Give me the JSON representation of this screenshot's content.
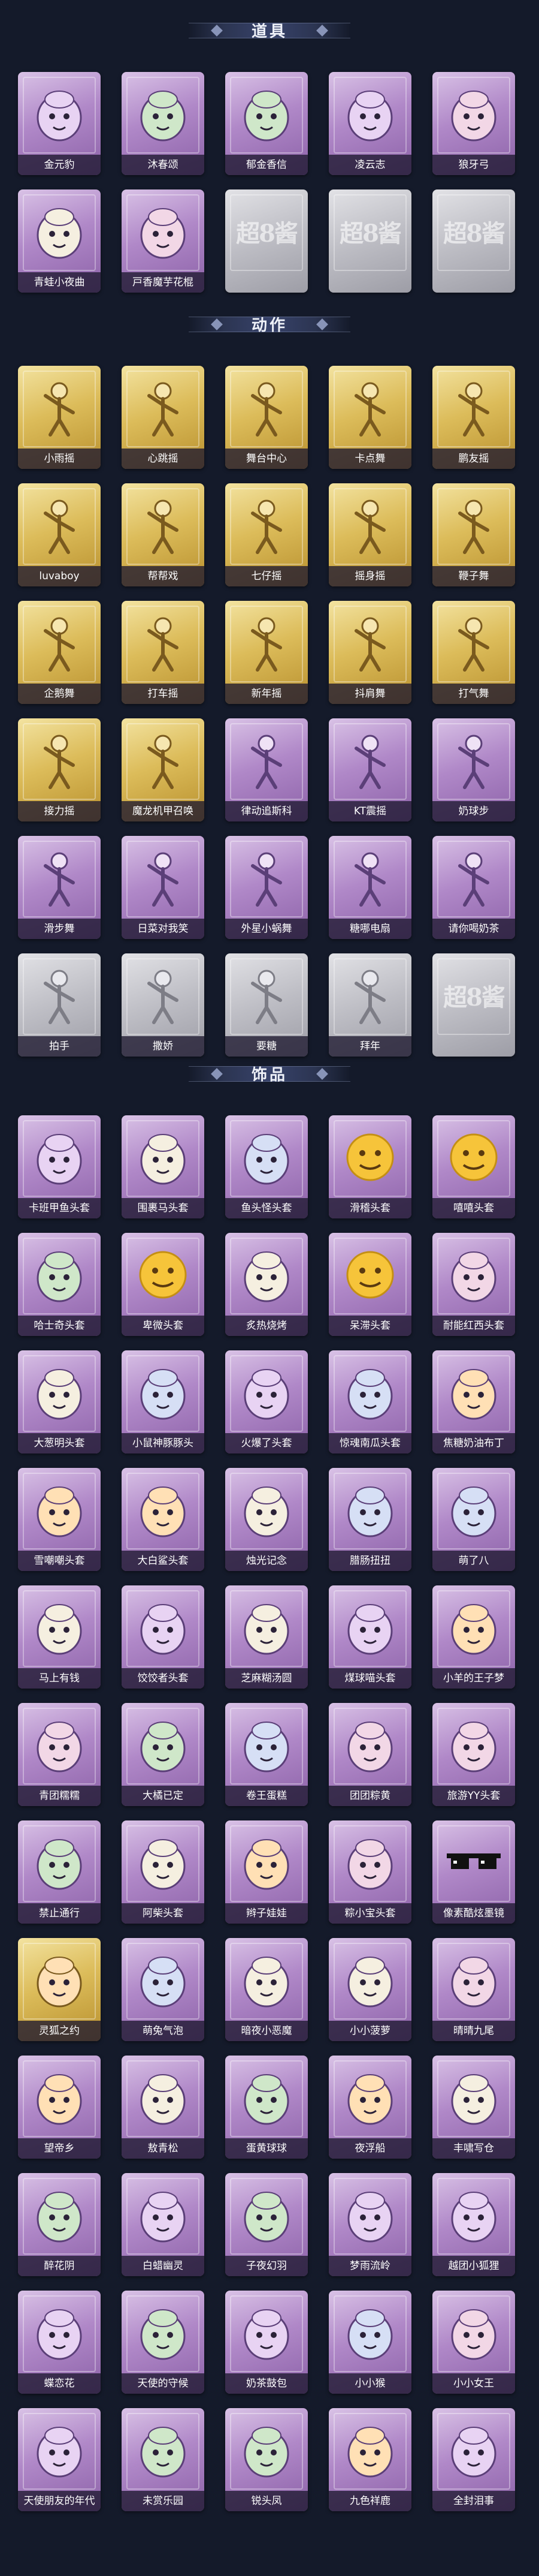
{
  "sections": [
    {
      "title": "道具",
      "items": [
        {
          "label": "金元豹",
          "tone": "purple",
          "icon": "leopard-doll-icon"
        },
        {
          "label": "沐春颂",
          "tone": "purple",
          "icon": "flower-garland-icon"
        },
        {
          "label": "郁金香信",
          "tone": "purple",
          "icon": "tulip-letter-icon"
        },
        {
          "label": "凌云志",
          "tone": "purple",
          "icon": "wing-arrow-icon"
        },
        {
          "label": "狼牙弓",
          "tone": "purple",
          "icon": "bow-icon"
        },
        {
          "label": "青蛙小夜曲",
          "tone": "purple",
          "icon": "frog-icon"
        },
        {
          "label": "戸香魔芋花棍",
          "tone": "purple",
          "icon": "flower-club-icon"
        },
        {
          "label": "",
          "tone": "grey",
          "icon": "placeholder-icon",
          "placeholder": "超8酱"
        },
        {
          "label": "",
          "tone": "grey",
          "icon": "placeholder-icon",
          "placeholder": "超8酱"
        },
        {
          "label": "",
          "tone": "grey",
          "icon": "placeholder-icon",
          "placeholder": "超8酱"
        }
      ]
    },
    {
      "title": "动作",
      "items": [
        {
          "label": "小雨摇",
          "tone": "gold",
          "icon": "dance-pose-icon"
        },
        {
          "label": "心跳摇",
          "tone": "gold",
          "icon": "dance-pose-icon"
        },
        {
          "label": "舞台中心",
          "tone": "gold",
          "icon": "dance-pose-icon"
        },
        {
          "label": "卡点舞",
          "tone": "gold",
          "icon": "dance-pose-icon"
        },
        {
          "label": "鹏友摇",
          "tone": "gold",
          "icon": "dance-pose-icon"
        },
        {
          "label": "luvaboy",
          "tone": "gold",
          "icon": "dance-pose-icon"
        },
        {
          "label": "帮帮戏",
          "tone": "gold",
          "icon": "dance-pose-icon"
        },
        {
          "label": "七仔摇",
          "tone": "gold",
          "icon": "dance-pose-icon"
        },
        {
          "label": "摇身摇",
          "tone": "gold",
          "icon": "dance-pose-icon"
        },
        {
          "label": "鞭子舞",
          "tone": "gold",
          "icon": "dance-pose-icon"
        },
        {
          "label": "企鹅舞",
          "tone": "gold",
          "icon": "dance-pose-icon"
        },
        {
          "label": "打车摇",
          "tone": "gold",
          "icon": "dance-pose-icon"
        },
        {
          "label": "新年摇",
          "tone": "gold",
          "icon": "dance-pose-icon"
        },
        {
          "label": "抖肩舞",
          "tone": "gold",
          "icon": "dance-pose-icon"
        },
        {
          "label": "打气舞",
          "tone": "gold",
          "icon": "dance-pose-icon"
        },
        {
          "label": "接力摇",
          "tone": "gold",
          "icon": "dance-pose-icon"
        },
        {
          "label": "魔龙机甲召唤",
          "tone": "gold",
          "icon": "dance-pose-icon"
        },
        {
          "label": "律动追斯科",
          "tone": "purple",
          "icon": "dance-pose-icon"
        },
        {
          "label": "KT震摇",
          "tone": "purple",
          "icon": "dance-pose-icon"
        },
        {
          "label": "奶球步",
          "tone": "purple",
          "icon": "dance-pose-icon"
        },
        {
          "label": "滑步舞",
          "tone": "purple",
          "icon": "dance-pose-icon"
        },
        {
          "label": "日菜对我笑",
          "tone": "purple",
          "icon": "dance-pose-icon"
        },
        {
          "label": "外星小蜗舞",
          "tone": "purple",
          "icon": "dance-pose-icon"
        },
        {
          "label": "糖哪电扇",
          "tone": "purple",
          "icon": "dance-pose-icon"
        },
        {
          "label": "请你喝奶茶",
          "tone": "purple",
          "icon": "dance-pose-icon"
        },
        {
          "label": "拍手",
          "tone": "grey",
          "icon": "dance-pose-icon"
        },
        {
          "label": "撒娇",
          "tone": "grey",
          "icon": "dance-pose-icon"
        },
        {
          "label": "要糖",
          "tone": "grey",
          "icon": "dance-pose-icon"
        },
        {
          "label": "拜年",
          "tone": "grey",
          "icon": "dance-pose-icon"
        },
        {
          "label": "",
          "tone": "grey",
          "icon": "placeholder-icon",
          "placeholder": "超8酱"
        }
      ]
    },
    {
      "title": "饰品",
      "items": [
        {
          "label": "卡班甲鱼头套",
          "tone": "purple",
          "icon": "penguin-head-icon"
        },
        {
          "label": "围裹马头套",
          "tone": "purple",
          "icon": "horse-head-icon"
        },
        {
          "label": "鱼头怪头套",
          "tone": "purple",
          "icon": "fish-head-icon"
        },
        {
          "label": "滑稽头套",
          "tone": "purple",
          "icon": "emoji-face-icon"
        },
        {
          "label": "嘻嘻头套",
          "tone": "purple",
          "icon": "emoji-face-icon"
        },
        {
          "label": "哈士奇头套",
          "tone": "purple",
          "icon": "husky-head-icon"
        },
        {
          "label": "卑微头套",
          "tone": "purple",
          "icon": "emoji-face-icon"
        },
        {
          "label": "炙热烧烤",
          "tone": "purple",
          "icon": "toast-head-icon"
        },
        {
          "label": "呆滞头套",
          "tone": "purple",
          "icon": "emoji-face-icon"
        },
        {
          "label": "耐能红西头套",
          "tone": "purple",
          "icon": "pikachu-head-icon"
        },
        {
          "label": "大葱明头套",
          "tone": "purple",
          "icon": "bokchoy-head-icon"
        },
        {
          "label": "小鼠神豚豚头",
          "tone": "purple",
          "icon": "pig-head-icon"
        },
        {
          "label": "火爆了头套",
          "tone": "purple",
          "icon": "fire-head-icon"
        },
        {
          "label": "惊魂南瓜头套",
          "tone": "purple",
          "icon": "pumpkin-head-icon"
        },
        {
          "label": "焦糖奶油布丁",
          "tone": "purple",
          "icon": "pudding-head-icon"
        },
        {
          "label": "雪嘲嘲头套",
          "tone": "purple",
          "icon": "snowman-head-icon"
        },
        {
          "label": "大白鲨头套",
          "tone": "purple",
          "icon": "shark-head-icon"
        },
        {
          "label": "烛光记念",
          "tone": "purple",
          "icon": "candle-head-icon"
        },
        {
          "label": "腊肠扭扭",
          "tone": "purple",
          "icon": "dachshund-head-icon"
        },
        {
          "label": "萌了八",
          "tone": "purple",
          "icon": "garlic-head-icon"
        },
        {
          "label": "马上有钱",
          "tone": "purple",
          "icon": "bird-head-icon"
        },
        {
          "label": "饺饺者头套",
          "tone": "purple",
          "icon": "dumpling-head-icon"
        },
        {
          "label": "芝麻糊汤圆",
          "tone": "purple",
          "icon": "tangyuan-head-icon"
        },
        {
          "label": "煤球喵头套",
          "tone": "purple",
          "icon": "cat-head-icon"
        },
        {
          "label": "小羊的王子梦",
          "tone": "purple",
          "icon": "sheep-head-icon"
        },
        {
          "label": "青团糯糯",
          "tone": "purple",
          "icon": "qingtuan-head-icon"
        },
        {
          "label": "大橘已定",
          "tone": "purple",
          "icon": "orange-head-icon"
        },
        {
          "label": "卷王蛋糕",
          "tone": "purple",
          "icon": "cake-head-icon"
        },
        {
          "label": "团团粽黄",
          "tone": "purple",
          "icon": "zongzi-head-icon"
        },
        {
          "label": "旅游YY头套",
          "tone": "purple",
          "icon": "duck-head-icon"
        },
        {
          "label": "禁止通行",
          "tone": "purple",
          "icon": "traffic-cone-icon"
        },
        {
          "label": "阿柴头套",
          "tone": "purple",
          "icon": "shiba-head-icon"
        },
        {
          "label": "辫子娃娃",
          "tone": "purple",
          "icon": "braid-doll-icon"
        },
        {
          "label": "粽小宝头套",
          "tone": "purple",
          "icon": "zongzi-head-icon"
        },
        {
          "label": "像素酷炫墨镜",
          "tone": "purple",
          "icon": "pixel-sunglasses-icon"
        },
        {
          "label": "灵狐之约",
          "tone": "gold",
          "icon": "fox-mask-icon"
        },
        {
          "label": "萌兔气泡",
          "tone": "purple",
          "icon": "rabbit-bubble-icon"
        },
        {
          "label": "暗夜小恶魔",
          "tone": "purple",
          "icon": "devil-pet-icon"
        },
        {
          "label": "小小菠萝",
          "tone": "purple",
          "icon": "pineapple-pet-icon"
        },
        {
          "label": "晴晴九尾",
          "tone": "purple",
          "icon": "ninetail-pet-icon"
        },
        {
          "label": "望帝乡",
          "tone": "purple",
          "icon": "emperor-pet-icon"
        },
        {
          "label": "敖青松",
          "tone": "purple",
          "icon": "pine-pet-icon"
        },
        {
          "label": "蛋黄球球",
          "tone": "purple",
          "icon": "egg-pet-icon"
        },
        {
          "label": "夜浮船",
          "tone": "purple",
          "icon": "boat-pet-icon"
        },
        {
          "label": "丰啸写仓",
          "tone": "purple",
          "icon": "granary-pet-icon"
        },
        {
          "label": "醉花阴",
          "tone": "purple",
          "icon": "flower-pet-icon"
        },
        {
          "label": "白蜡幽灵",
          "tone": "purple",
          "icon": "ghost-pet-icon"
        },
        {
          "label": "子夜幻羽",
          "tone": "purple",
          "icon": "feather-pet-icon"
        },
        {
          "label": "梦雨流岭",
          "tone": "purple",
          "icon": "dreamgirl-pet-icon"
        },
        {
          "label": "越团小狐狸",
          "tone": "purple",
          "icon": "fox-pet-icon"
        },
        {
          "label": "蝶恋花",
          "tone": "purple",
          "icon": "butterfly-pet-icon"
        },
        {
          "label": "天使的守候",
          "tone": "purple",
          "icon": "angel-pet-icon"
        },
        {
          "label": "奶茶鼓包",
          "tone": "purple",
          "icon": "milktea-pet-icon"
        },
        {
          "label": "小小猴",
          "tone": "purple",
          "icon": "monkey-pet-icon"
        },
        {
          "label": "小小女王",
          "tone": "purple",
          "icon": "queen-pet-icon"
        },
        {
          "label": "天使朋友的年代",
          "tone": "purple",
          "icon": "angel-mirror-icon"
        },
        {
          "label": "未赏乐园",
          "tone": "purple",
          "icon": "park-girl-icon"
        },
        {
          "label": "锐头凤",
          "tone": "purple",
          "icon": "phoenix-pet-icon"
        },
        {
          "label": "九色祥鹿",
          "tone": "purple",
          "icon": "deer-pet-icon"
        },
        {
          "label": "全封泪事",
          "tone": "purple",
          "icon": "prince-pet-icon"
        }
      ]
    }
  ]
}
